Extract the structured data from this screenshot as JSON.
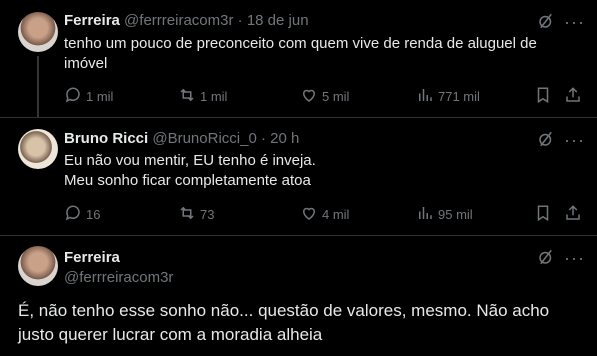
{
  "tweets": [
    {
      "name": "Ferreira",
      "handle": "@ferrreiracom3r",
      "separator": "·",
      "date": "18 de jun",
      "text_line1": "tenho um pouco de preconceito com quem vive de renda de aluguel de",
      "text_line2": "imóvel",
      "replies": "1 mil",
      "retweets": "1 mil",
      "likes": "5 mil",
      "views": "771 mil"
    },
    {
      "name": "Bruno Ricci",
      "handle": "@BrunoRicci_0",
      "separator": "·",
      "date": "20 h",
      "text_line1": "Eu não vou mentir, EU tenho é inveja.",
      "text_line2": "Meu sonho ficar completamente atoa",
      "replies": "16",
      "retweets": "73",
      "likes": "4 mil",
      "views": "95 mil"
    },
    {
      "name": "Ferreira",
      "handle": "@ferrreiracom3r",
      "text_line1": "É, não tenho esse sonho não... questão de valores, mesmo. Não acho",
      "text_line2": "justo querer lucrar com a moradia alheia"
    }
  ],
  "more_symbol": "···",
  "colors": {
    "background": "#000000",
    "text": "#e7e9ea",
    "muted": "#71767b",
    "divider": "#2f3336"
  },
  "icons": [
    "avatar",
    "grok-icon",
    "more-icon",
    "reply-icon",
    "retweet-icon",
    "like-icon",
    "views-icon",
    "bookmark-icon",
    "share-icon"
  ]
}
